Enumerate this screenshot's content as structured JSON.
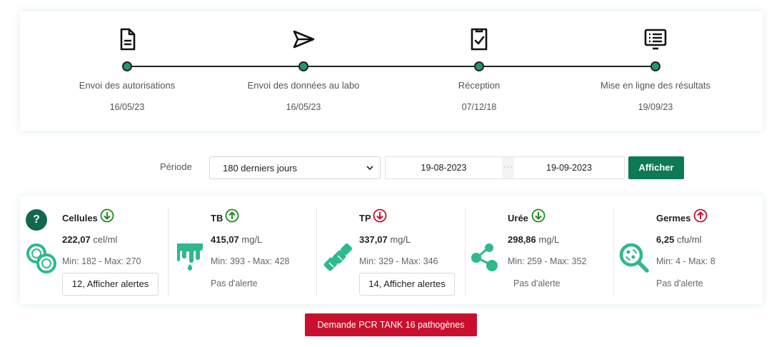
{
  "timeline": {
    "steps": [
      {
        "label": "Envoi des autorisations",
        "date": "16/05/23",
        "icon": "document-icon"
      },
      {
        "label": "Envoi des données au labo",
        "date": "16/05/23",
        "icon": "send-icon"
      },
      {
        "label": "Réception",
        "date": "07/12/18",
        "icon": "document-check-icon"
      },
      {
        "label": "Mise en ligne des résultats",
        "date": "19/09/23",
        "icon": "monitor-list-icon"
      }
    ]
  },
  "period": {
    "label": "Période",
    "selected": "180 derniers jours",
    "date_from": "19-08-2023",
    "date_separator": "···",
    "date_to": "19-09-2023",
    "submit_label": "Afficher"
  },
  "metrics": {
    "help_label": "?",
    "items": [
      {
        "title": "Cellules",
        "trend": "down",
        "value": "222,07",
        "unit": "cel/ml",
        "range": "Min: 182 - Max: 270",
        "alert": "12, Afficher alertes",
        "alert_is_button": true,
        "icon": "cells-icon"
      },
      {
        "title": "TB",
        "trend": "up",
        "value": "415,07",
        "unit": "mg/L",
        "range": "Min: 393 - Max: 428",
        "alert": "Pas d'alerte",
        "alert_is_button": false,
        "icon": "milk-drip-icon"
      },
      {
        "title": "TP",
        "trend": "down",
        "value": "337,07",
        "unit": "mg/L",
        "range": "Min: 329 - Max: 346",
        "alert": "14, Afficher alertes",
        "alert_is_button": true,
        "icon": "protein-icon"
      },
      {
        "title": "Urée",
        "trend": "down",
        "value": "298,86",
        "unit": "mg/L",
        "range": "Min: 259 - Max: 352",
        "alert": "Pas d'alerte",
        "alert_is_button": false,
        "icon": "molecule-icon"
      },
      {
        "title": "Germes",
        "trend": "up",
        "value": "6,25",
        "unit": "cfu/ml",
        "range": "Min: 4 - Max: 8",
        "alert": "Pas d'alerte",
        "alert_is_button": false,
        "icon": "germ-search-icon"
      }
    ]
  },
  "pcr_button": "Demande PCR TANK 16 pathogènes",
  "colors": {
    "accent": "#1d9a72",
    "trend_green": "#1e8a1e",
    "trend_red": "#c8102e",
    "pcr_red": "#c8102e",
    "button_green": "#0e7a55"
  }
}
